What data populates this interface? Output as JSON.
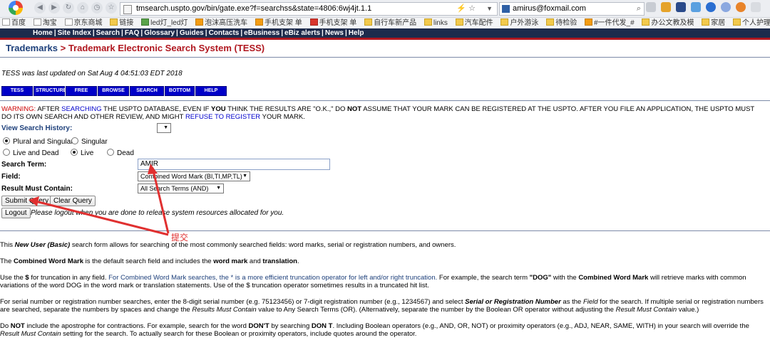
{
  "browser": {
    "url": "tmsearch.uspto.gov/bin/gate.exe?f=searchss&state=4806:6wj4jt.1.1",
    "search_value": "amirus@foxmail.com",
    "bookmarks": [
      "百度",
      "淘宝",
      "京东商城",
      "链接",
      "led灯_led灯",
      "泡沫高压洗车",
      "手机支架 单",
      "手机支架 单",
      "自行车新产品",
      "links",
      "汽车配件",
      "户外游泳",
      "待检验",
      "#一件代发_#",
      "办公文教及模",
      "家居",
      "个人护理"
    ]
  },
  "site_nav": [
    "Home",
    "Site Index",
    "Search",
    "FAQ",
    "Glossary",
    "Guides",
    "Contacts",
    "eBusiness",
    "eBiz alerts",
    "News",
    "Help"
  ],
  "page": {
    "title_part1": "Trademarks",
    "title_sep": " > ",
    "title_part2": "Trademark Electronic Search System (TESS)",
    "updated": "TESS was last updated on Sat Aug 4 04:51:03 EDT 2018"
  },
  "tess_buttons": [
    "TESS HOME",
    "STRUCTURED",
    "FREE FORM",
    "BROWSE DICT",
    "SEARCH OG",
    "BOTTOM",
    "HELP"
  ],
  "warning": {
    "label": "WARNING:",
    "t1": " AFTER ",
    "searching": "SEARCHING",
    "t2": " THE USPTO DATABASE, EVEN IF ",
    "you": "YOU",
    "t3": " THINK THE RESULTS ARE \"O.K.,\" DO ",
    "not": "NOT",
    "t4": " ASSUME THAT YOUR MARK CAN BE REGISTERED AT THE USPTO. AFTER YOU FILE AN APPLICATION, THE USPTO MUST DO ITS OWN SEARCH AND OTHER REVIEW, AND MIGHT ",
    "refuse": "REFUSE TO REGISTER",
    "t5": " YOUR MARK."
  },
  "form": {
    "view_history_label": "View Search History:",
    "plural_singular": "Plural and Singular",
    "singular": "Singular",
    "live_and_dead": "Live and Dead",
    "live": "Live",
    "dead": "Dead",
    "search_term_label": "Search Term:",
    "search_term_value": "AMIR",
    "field_label": "Field:",
    "field_value": "Combined Word Mark (BI,TI,MP,TL)",
    "result_label": "Result Must Contain:",
    "result_value": "All Search Terms (AND)",
    "submit": "Submit Query",
    "clear": "Clear Query",
    "logout": "Logout",
    "logout_note": "Please logout when you are done to release system resources allocated for you."
  },
  "annotation": "提交",
  "help": {
    "p1a": "This ",
    "p1b": "New User (Basic)",
    "p1c": " search form allows for searching of the most commonly searched fields: word marks, serial or registration numbers, and owners.",
    "p2a": "The ",
    "p2b": "Combined Word Mark",
    "p2c": " is the default search field and includes the ",
    "p2d": "word mark",
    "p2e": " and ",
    "p2f": "translation",
    "p2g": ".",
    "p3a": "Use the ",
    "p3b": "$",
    "p3c": " for truncation in any field. ",
    "p3d": "For Combined Word Mark searches, the * is a more efficient truncation operator for left and/or right truncation.",
    "p3e": " For example, the search term ",
    "p3f": "\"DOG\"",
    "p3g": " with the ",
    "p3h": "Combined Word Mark",
    "p3i": " will retrieve marks with common variations of the word DOG in the word mark or translation statements. Use of the $ truncation operator sometimes results in a truncated hit list.",
    "p4a": "For serial number or registration number searches, enter the 8-digit serial number (e.g. 75123456) or 7-digit registration number (e.g., 1234567) and select ",
    "p4b": "Serial or Registration Number",
    "p4c": " as the ",
    "p4d": "Field",
    "p4e": " for the search. If multiple serial or registration numbers are searched, separate the numbers by spaces and change the ",
    "p4f": "Results Must Contain",
    "p4g": " value to Any Search Terms (OR). (Alternatively, separate the number by the Boolean OR operator without adjusting the ",
    "p4h": "Result Must Contain",
    "p4i": " value.)",
    "p5a": "Do ",
    "p5b": "NOT",
    "p5c": " include the apostrophe for contractions. For example, search for the word ",
    "p5d": "DON'T",
    "p5e": " by searching ",
    "p5f": "DON T",
    "p5g": ". Including Boolean operators (e.g., AND, OR, NOT) or proximity operators (e.g., ADJ, NEAR, SAME, WITH) in your search will override the ",
    "p5h": "Result Must Contain",
    "p5i": " setting for the search. To actually search for these Boolean or proximity operators, include quotes around the operator."
  }
}
